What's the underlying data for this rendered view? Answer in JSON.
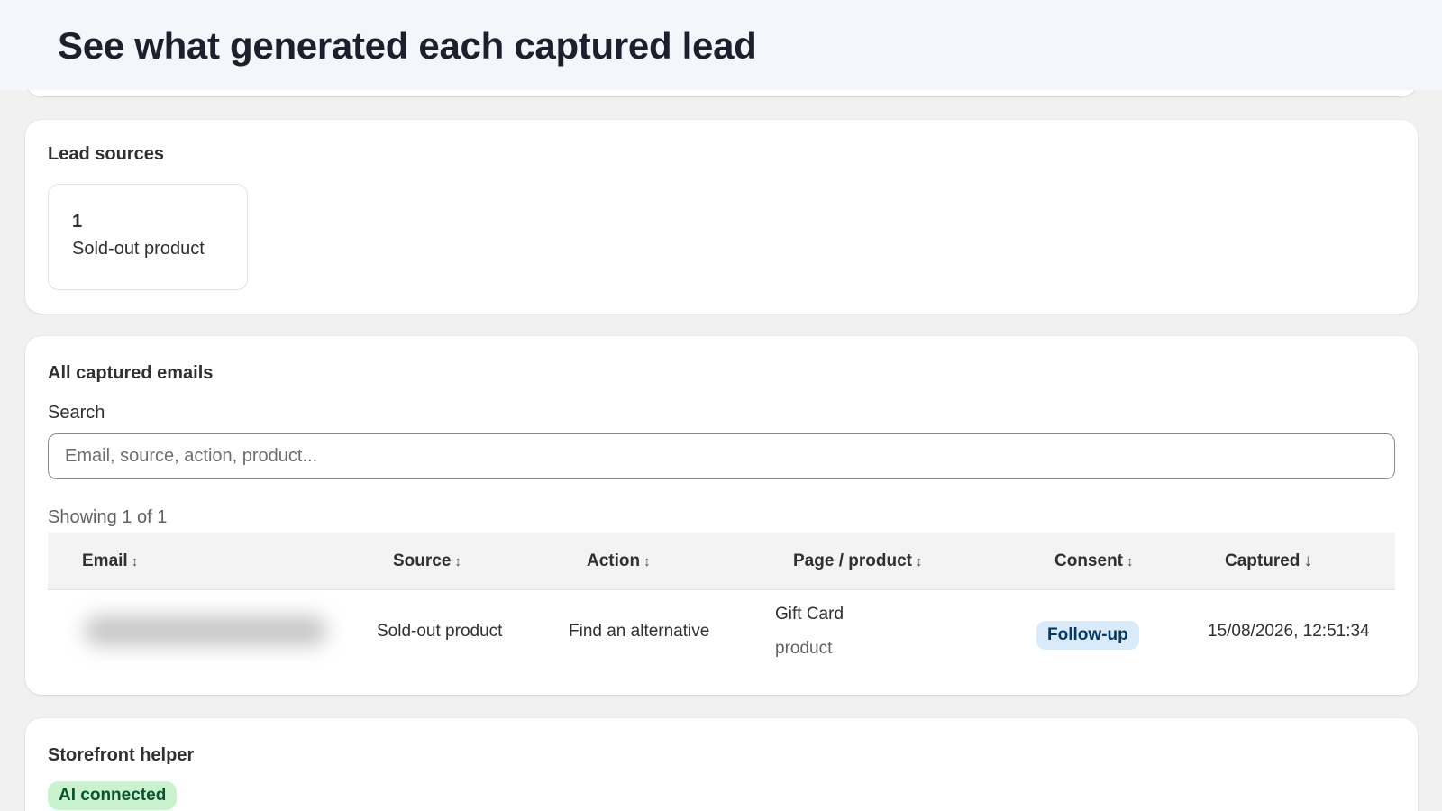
{
  "hero": {
    "title": "See what generated each captured lead"
  },
  "lead_sources": {
    "title": "Lead sources",
    "items": [
      {
        "count": "1",
        "label": "Sold-out product"
      }
    ]
  },
  "emails": {
    "title": "All captured emails",
    "search": {
      "label": "Search",
      "placeholder": "Email, source, action, product..."
    },
    "showing": "Showing 1 of 1",
    "columns": [
      {
        "label": "Email",
        "sort": "↕"
      },
      {
        "label": "Source",
        "sort": "↕"
      },
      {
        "label": "Action",
        "sort": "↕"
      },
      {
        "label": "Page / product",
        "sort": "↕"
      },
      {
        "label": "Consent",
        "sort": "↕"
      },
      {
        "label": "Captured",
        "sort": "↓"
      }
    ],
    "rows": [
      {
        "email": "",
        "source": "Sold-out product",
        "action": "Find an alternative",
        "page": "Gift Card",
        "page_type": "product",
        "consent": "Follow-up",
        "captured": "15/08/2026, 12:51:34"
      }
    ]
  },
  "helper": {
    "title": "Storefront helper",
    "status": "AI connected"
  },
  "colors": {
    "consent_badge_bg": "#d9ebfa",
    "ai_badge_bg": "#c9f2cf",
    "hero_bg": "#f5f5fc"
  }
}
